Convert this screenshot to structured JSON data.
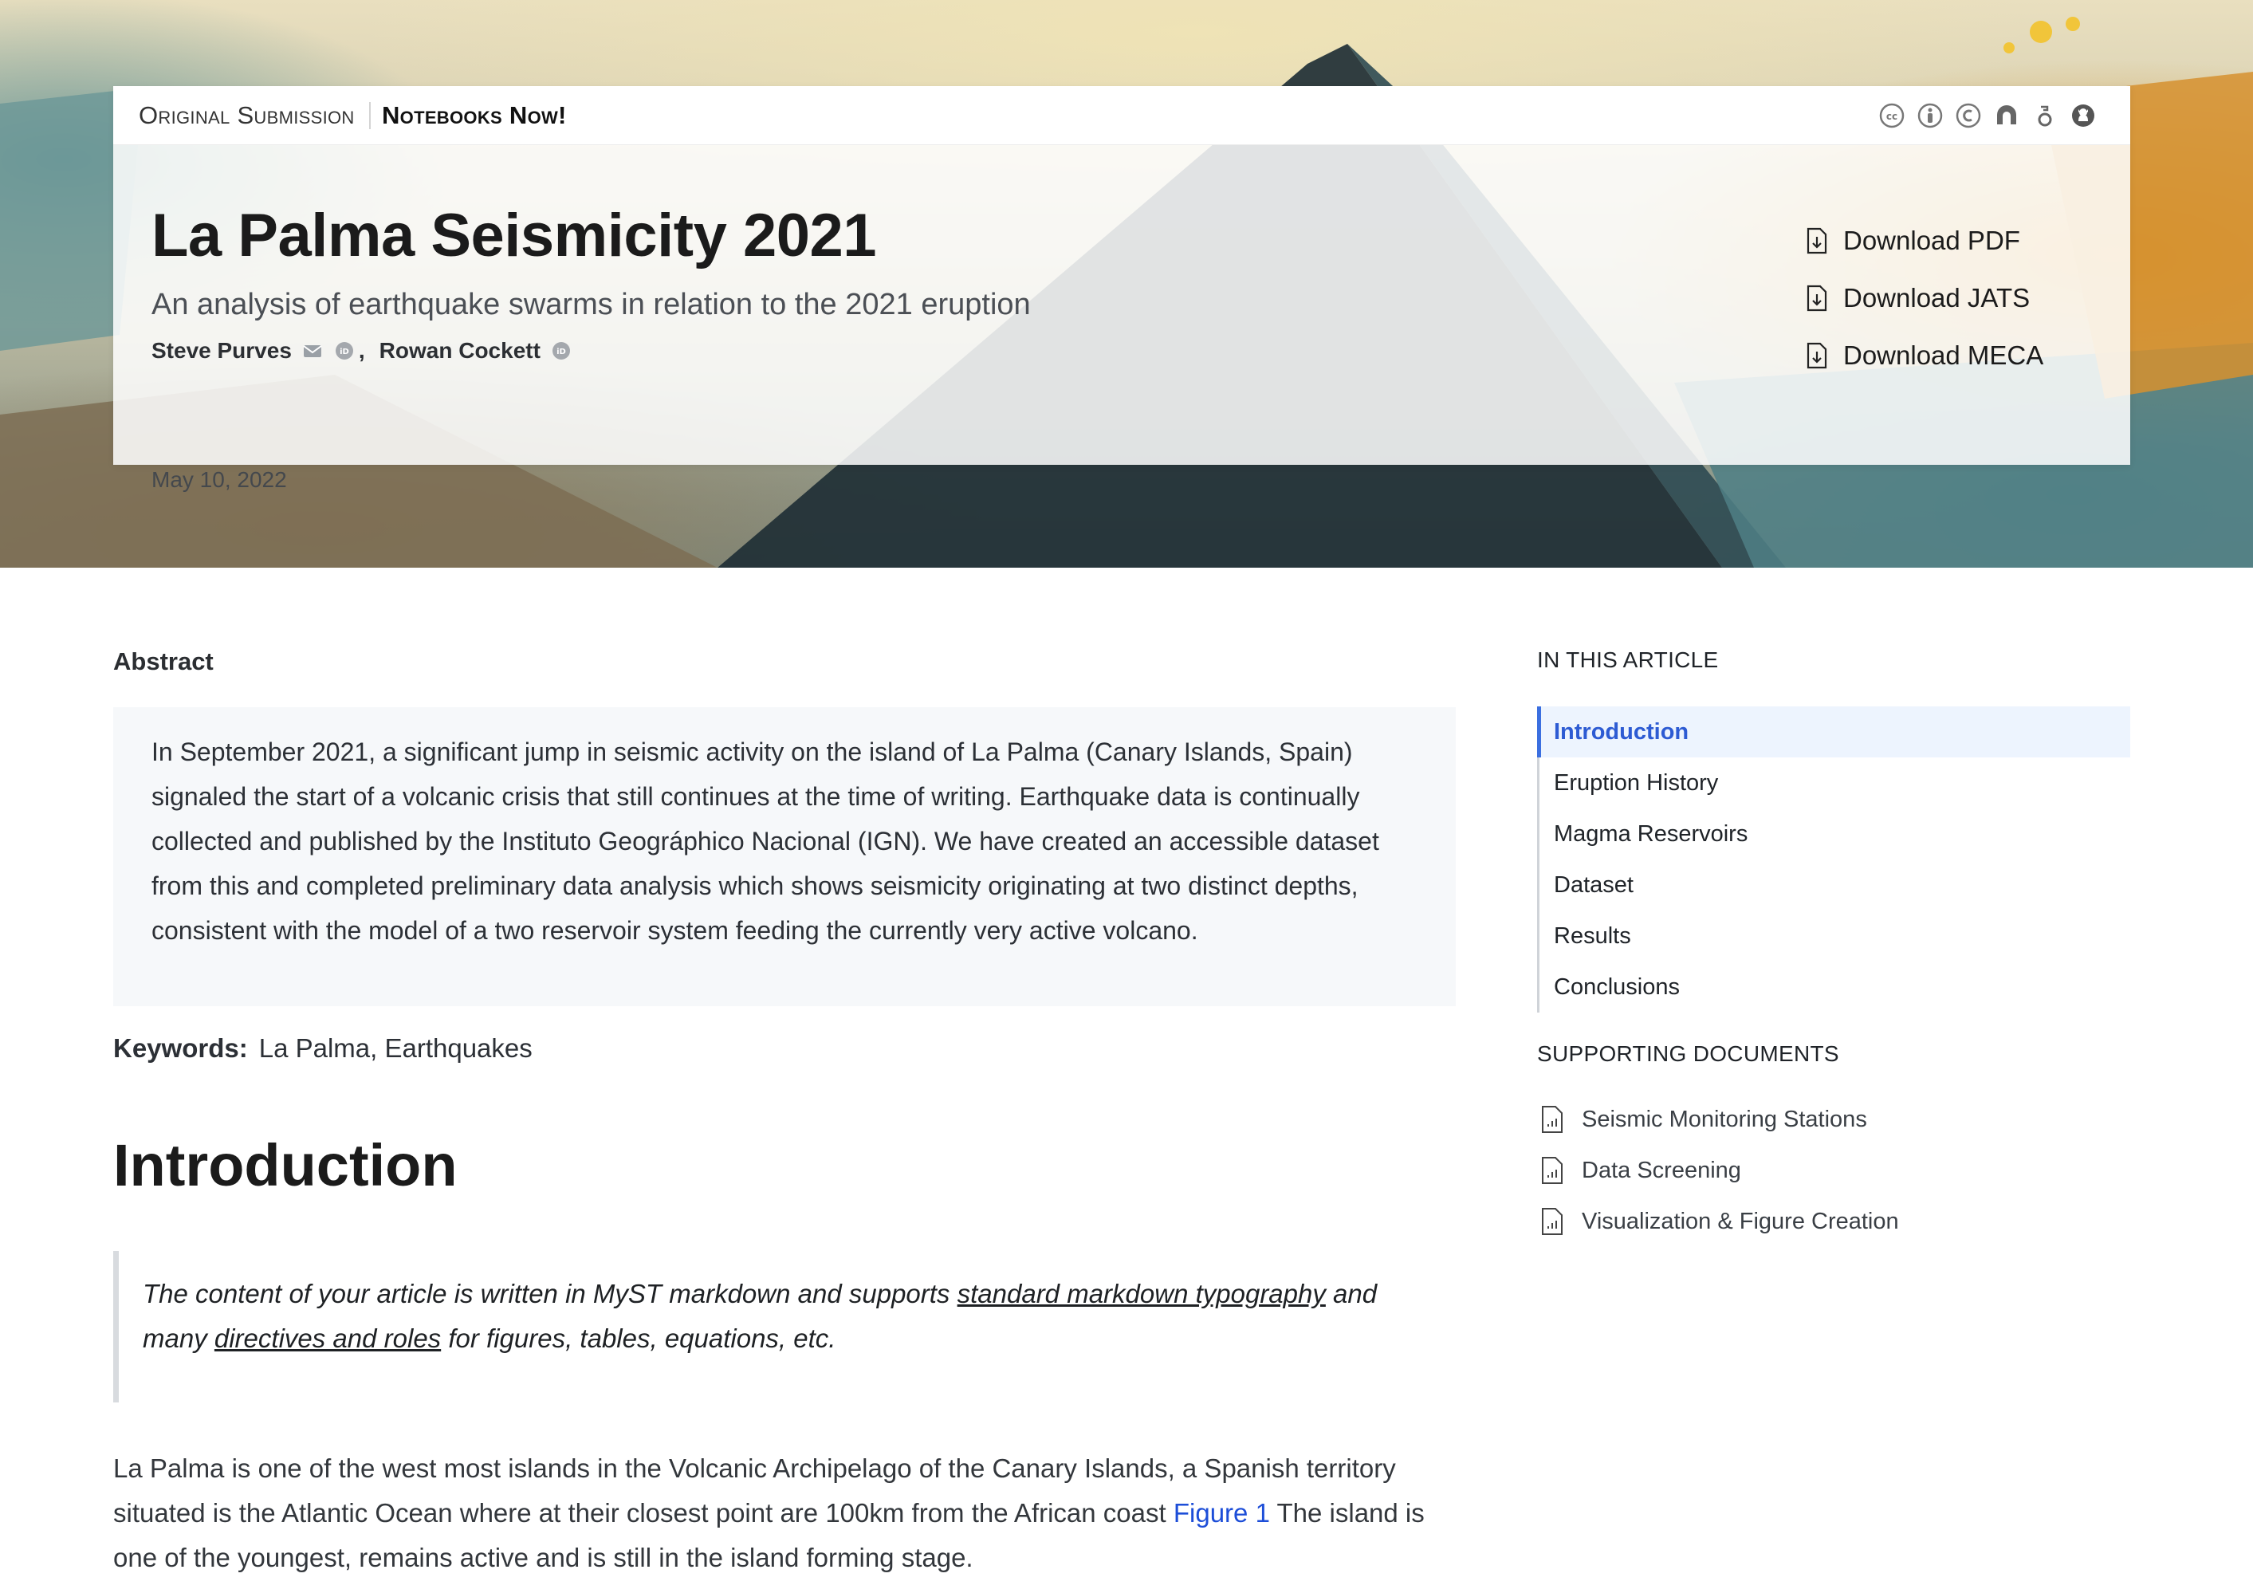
{
  "header": {
    "venue_primary": "Original Submission",
    "venue_secondary": "Notebooks Now!",
    "license_icons": [
      "cc-icon",
      "by-icon",
      "copyright-icon",
      "open-access-icon",
      "orcid-icon",
      "github-icon"
    ]
  },
  "article": {
    "title": "La Palma Seismicity 2021",
    "subtitle": "An analysis of earthquake swarms in relation to the 2021 eruption",
    "authors": [
      {
        "name": "Steve Purves",
        "has_email": true,
        "has_orcid": true
      },
      {
        "name": "Rowan Cockett",
        "has_email": false,
        "has_orcid": true
      }
    ],
    "author_separator": ",",
    "date": "May 10, 2022"
  },
  "downloads": [
    {
      "label": "Download PDF",
      "icon": "file-download-icon"
    },
    {
      "label": "Download JATS",
      "icon": "file-download-icon"
    },
    {
      "label": "Download MECA",
      "icon": "file-download-icon"
    }
  ],
  "abstract": {
    "label": "Abstract",
    "text": "In September 2021, a significant jump in seismic activity on the island of La Palma (Canary Islands, Spain) signaled the start of a volcanic crisis that still continues at the time of writing. Earthquake data is continually collected and published by the Instituto Geográphico Nacional (IGN). We have created an accessible dataset from this and completed preliminary data analysis which shows seismicity originating at two distinct depths, consistent with the model of a two reservoir system feeding the currently very active volcano."
  },
  "keywords": {
    "label": "Keywords:",
    "value": "La Palma, Earthquakes"
  },
  "introduction": {
    "heading": "Introduction",
    "quote_part1": "The content of your article is written in MyST markdown and supports ",
    "quote_link1": "standard markdown typography",
    "quote_part2": " and many ",
    "quote_link2": "directives and roles",
    "quote_part3": " for figures, tables, equations, etc.",
    "para_part1": "La Palma is one of the west most islands in the Volcanic Archipelago of the Canary Islands, a Spanish territory situated is the Atlantic Ocean where at their closest point are 100km from the African coast ",
    "para_link": "Figure 1",
    "para_part2": " The island is one of the youngest, remains active and is still in the island forming stage."
  },
  "sidebar": {
    "toc_heading": "IN THIS ARTICLE",
    "toc": [
      {
        "label": "Introduction",
        "active": true
      },
      {
        "label": "Eruption History",
        "active": false
      },
      {
        "label": "Magma Reservoirs",
        "active": false
      },
      {
        "label": "Dataset",
        "active": false
      },
      {
        "label": "Results",
        "active": false
      },
      {
        "label": "Conclusions",
        "active": false
      }
    ],
    "docs_heading": "SUPPORTING DOCUMENTS",
    "docs": [
      {
        "label": "Seismic Monitoring Stations",
        "icon": "notebook-doc-icon"
      },
      {
        "label": "Data Screening",
        "icon": "notebook-doc-icon"
      },
      {
        "label": "Visualization & Figure Creation",
        "icon": "notebook-doc-icon"
      }
    ]
  },
  "colors": {
    "accent": "#3b6fe0",
    "link": "#1d4ed8",
    "abstract_bg": "#f6f8fa",
    "toc_active_bg": "#edf4fe"
  }
}
